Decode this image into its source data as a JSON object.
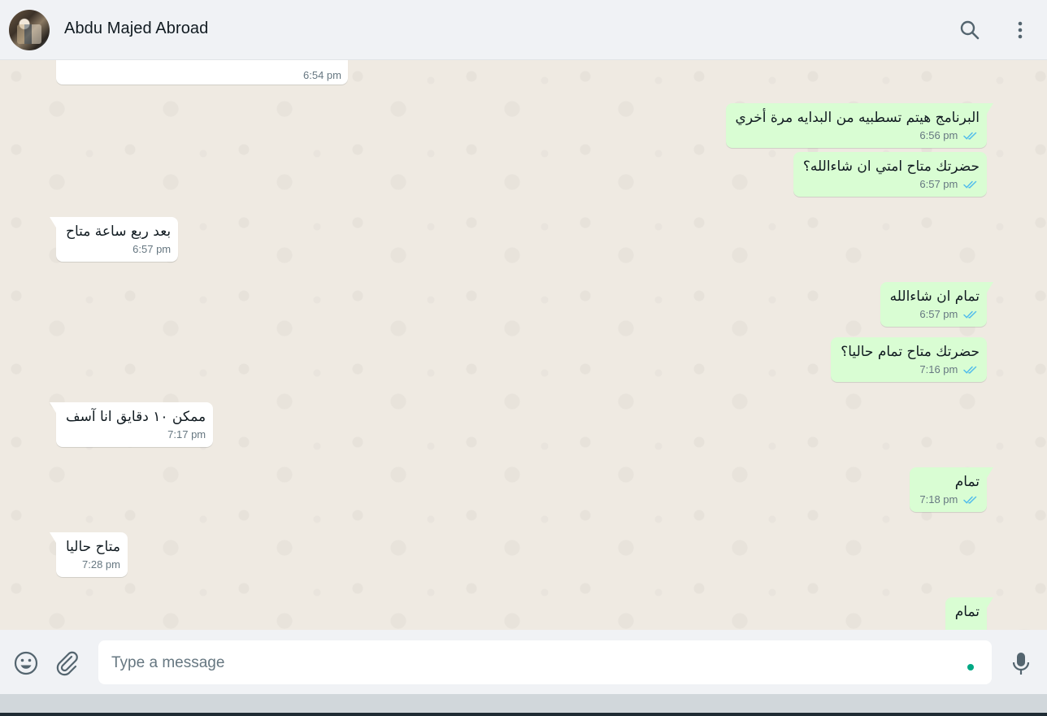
{
  "header": {
    "contact_name": "Abdu Majed Abroad",
    "icons": [
      "search-icon",
      "menu-dots-icon"
    ]
  },
  "messages": [
    {
      "dir": "in",
      "text": "",
      "time": "6:54 pm"
    },
    {
      "dir": "out",
      "text": "البرنامج هيتم تسطبيه من البدايه مرة أخري",
      "time": "6:56 pm",
      "status": "read"
    },
    {
      "dir": "out",
      "text": "حضرتك متاح امتي ان شاءالله؟",
      "time": "6:57 pm",
      "status": "read"
    },
    {
      "dir": "in",
      "text": "بعد ربع ساعة متاح",
      "time": "6:57 pm"
    },
    {
      "dir": "out",
      "text": "تمام ان شاءالله",
      "time": "6:57 pm",
      "status": "read"
    },
    {
      "dir": "out",
      "text": "حضرتك متاح تمام حاليا؟",
      "time": "7:16 pm",
      "status": "read"
    },
    {
      "dir": "in",
      "text": "ممكن ١٠ دقايق انا آسف",
      "time": "7:17 pm"
    },
    {
      "dir": "out",
      "text": "تمام",
      "time": "7:18 pm",
      "status": "read"
    },
    {
      "dir": "in",
      "text": "متاح حاليا",
      "time": "7:28 pm"
    },
    {
      "dir": "out",
      "text": "تمام",
      "time": "",
      "status": "read"
    }
  ],
  "composer": {
    "placeholder": "Type a message",
    "icons": [
      "emoji-icon",
      "attach-icon",
      "mic-icon"
    ]
  },
  "colors": {
    "incoming_bubble": "#ffffff",
    "outgoing_bubble": "#d9fdd3",
    "read_ticks": "#53bdeb",
    "accent": "#00a884",
    "chat_background": "#efeae2"
  }
}
